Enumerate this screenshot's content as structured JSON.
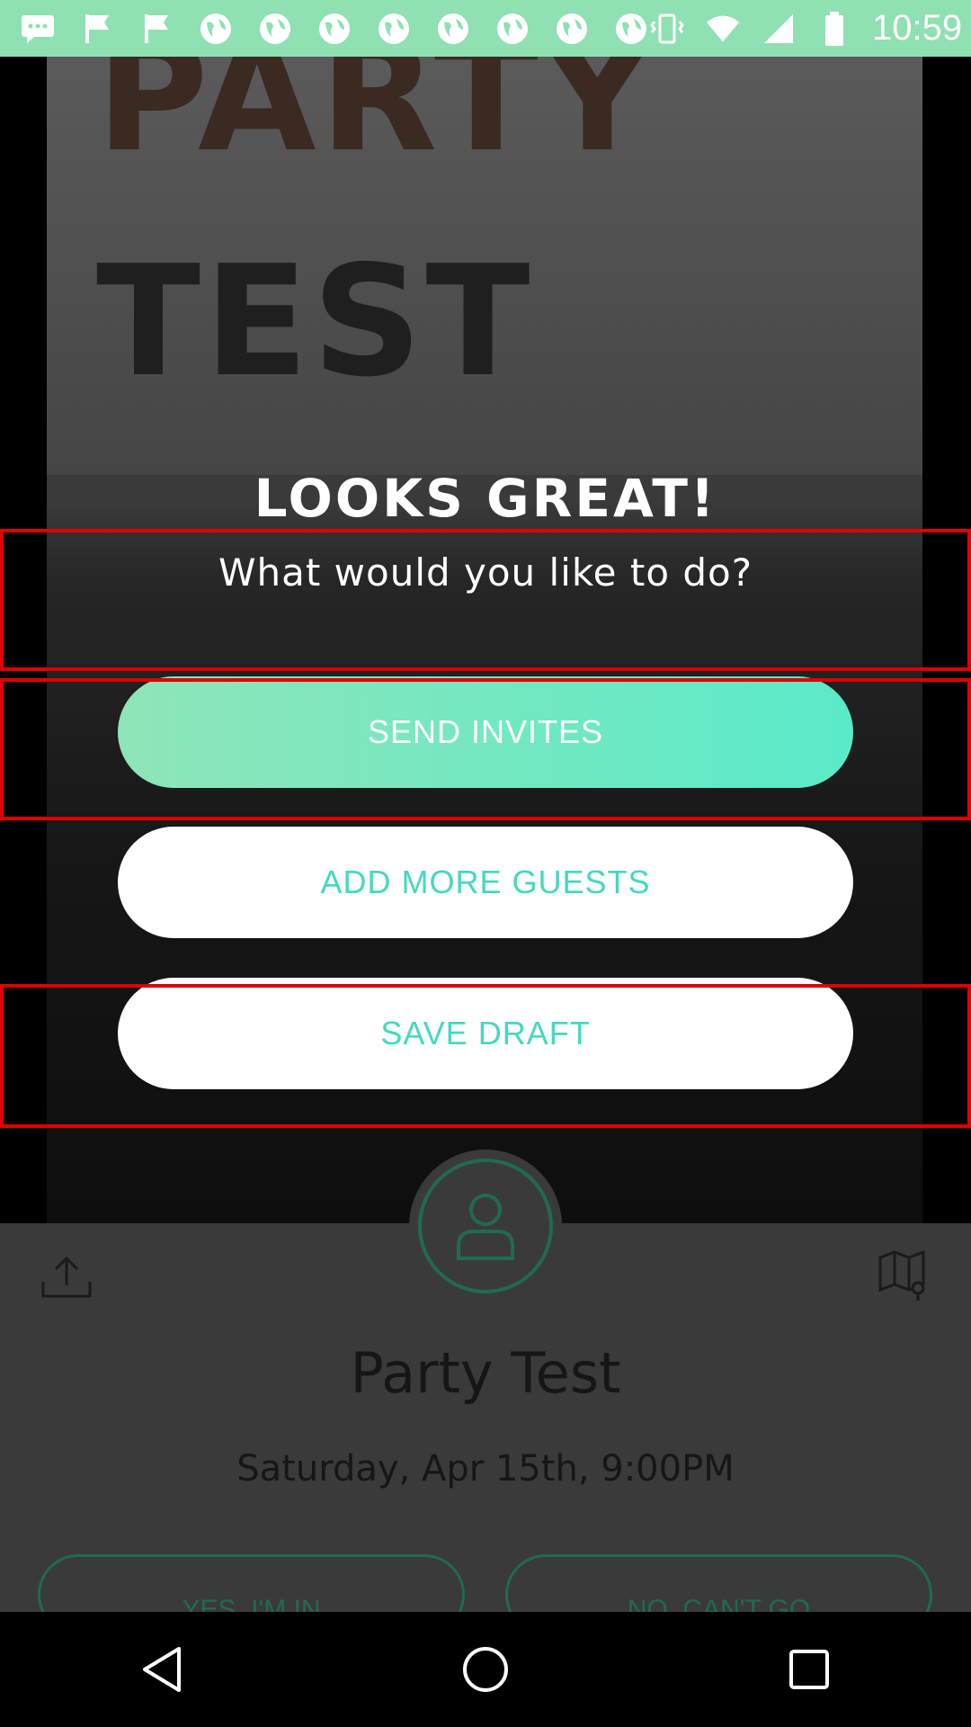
{
  "status_bar": {
    "time": "10:59",
    "left_icons": [
      "chat-icon",
      "flag-icon",
      "flag-icon",
      "globe-icon",
      "globe-icon",
      "globe-icon",
      "globe-icon",
      "globe-icon",
      "globe-icon",
      "globe-icon",
      "globe-icon"
    ],
    "right_icons": [
      "vibrate-icon",
      "wifi-icon",
      "cell-signal-icon",
      "battery-icon"
    ]
  },
  "poster": {
    "line1": "PARTY",
    "line2": "TEST"
  },
  "modal": {
    "title": "LOOKS GREAT!",
    "subtitle": "What would you like to do?",
    "send_invites_label": "SEND INVITES",
    "add_guests_label": "ADD MORE GUESTS",
    "save_draft_label": "SAVE DRAFT"
  },
  "event": {
    "title": "Party Test",
    "date": "Saturday, Apr 15th, 9:00PM",
    "rsvp_yes": "YES, I'M IN",
    "rsvp_no": "NO, CAN'T GO"
  },
  "colors": {
    "accent": "#45d9be",
    "status_bar": "#8fe0b3",
    "highlight": "#e00000"
  }
}
